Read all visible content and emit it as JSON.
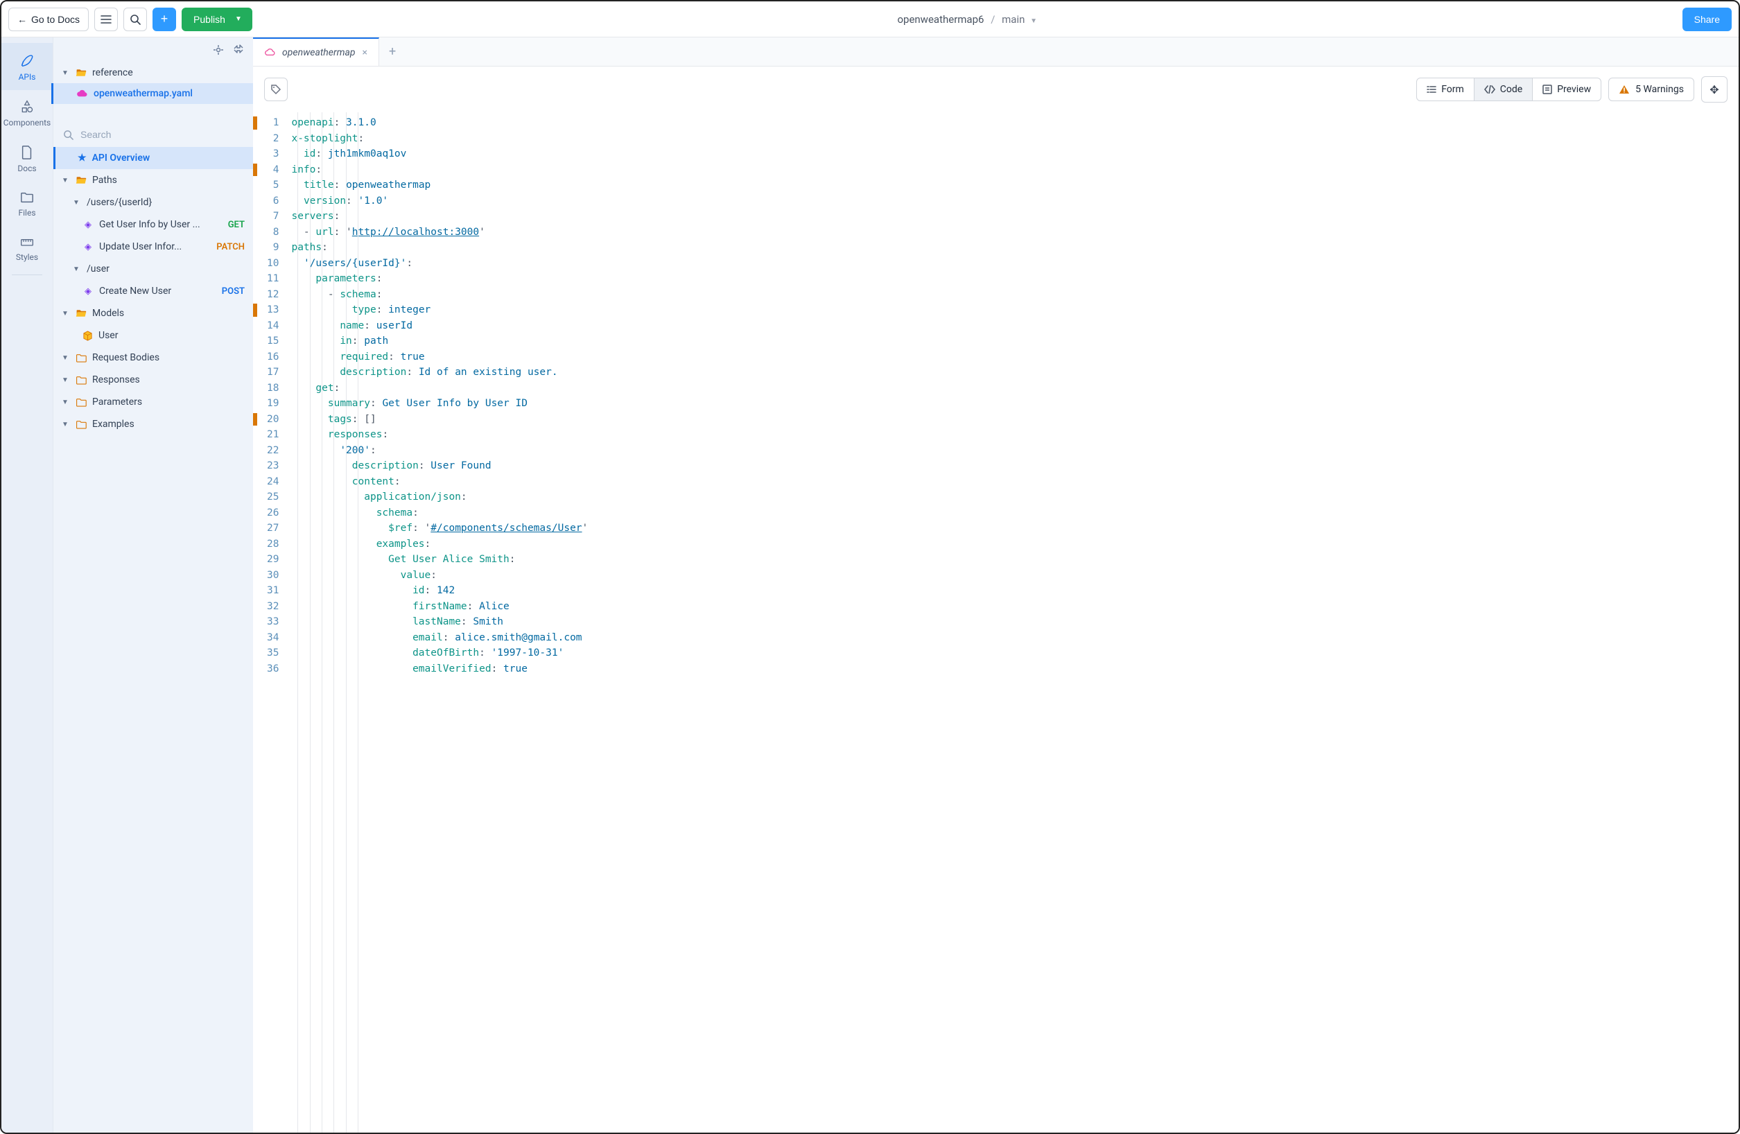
{
  "topbar": {
    "back_label": "Go to Docs",
    "publish_label": "Publish",
    "share_label": "Share",
    "project": "openweathermap6",
    "branch": "main"
  },
  "rail": {
    "apis": "APIs",
    "components": "Components",
    "docs": "Docs",
    "files": "Files",
    "styles": "Styles"
  },
  "sidebar": {
    "folder": "reference",
    "file": "openweathermap.yaml",
    "search_placeholder": "Search",
    "api_overview": "API Overview",
    "paths": "Paths",
    "path_users_id": "/users/{userId}",
    "op_get_user": "Get User Info by User ...",
    "op_get_user_method": "GET",
    "op_update_user": "Update User Infor...",
    "op_update_user_method": "PATCH",
    "path_user": "/user",
    "op_create_user": "Create New User",
    "op_create_user_method": "POST",
    "models": "Models",
    "model_user": "User",
    "request_bodies": "Request Bodies",
    "responses": "Responses",
    "parameters": "Parameters",
    "examples": "Examples"
  },
  "tab": {
    "title": "openweathermap"
  },
  "toolbar": {
    "form": "Form",
    "code": "Code",
    "preview": "Preview",
    "warnings": "5 Warnings"
  },
  "code": {
    "lines": [
      [
        [
          "key",
          "openapi"
        ],
        [
          "punc",
          ": "
        ],
        [
          "str",
          "3.1.0"
        ]
      ],
      [
        [
          "key",
          "x-stoplight"
        ],
        [
          "punc",
          ":"
        ]
      ],
      [
        [
          "punc",
          "  "
        ],
        [
          "key",
          "id"
        ],
        [
          "punc",
          ": "
        ],
        [
          "str",
          "jth1mkm0aq1ov"
        ]
      ],
      [
        [
          "key",
          "info"
        ],
        [
          "punc",
          ":"
        ]
      ],
      [
        [
          "punc",
          "  "
        ],
        [
          "key",
          "title"
        ],
        [
          "punc",
          ": "
        ],
        [
          "str",
          "openweathermap"
        ]
      ],
      [
        [
          "punc",
          "  "
        ],
        [
          "key",
          "version"
        ],
        [
          "punc",
          ": "
        ],
        [
          "str",
          "'1.0'"
        ]
      ],
      [
        [
          "key",
          "servers"
        ],
        [
          "punc",
          ":"
        ]
      ],
      [
        [
          "punc",
          "  - "
        ],
        [
          "key",
          "url"
        ],
        [
          "punc",
          ": '"
        ],
        [
          "url",
          "http://localhost:3000"
        ],
        [
          "punc",
          "'"
        ]
      ],
      [
        [
          "key",
          "paths"
        ],
        [
          "punc",
          ":"
        ]
      ],
      [
        [
          "punc",
          "  "
        ],
        [
          "str",
          "'/users/{userId}'"
        ],
        [
          "punc",
          ":"
        ]
      ],
      [
        [
          "punc",
          "    "
        ],
        [
          "key",
          "parameters"
        ],
        [
          "punc",
          ":"
        ]
      ],
      [
        [
          "punc",
          "      - "
        ],
        [
          "key",
          "schema"
        ],
        [
          "punc",
          ":"
        ]
      ],
      [
        [
          "punc",
          "          "
        ],
        [
          "key",
          "type"
        ],
        [
          "punc",
          ": "
        ],
        [
          "str",
          "integer"
        ]
      ],
      [
        [
          "punc",
          "        "
        ],
        [
          "key",
          "name"
        ],
        [
          "punc",
          ": "
        ],
        [
          "str",
          "userId"
        ]
      ],
      [
        [
          "punc",
          "        "
        ],
        [
          "key",
          "in"
        ],
        [
          "punc",
          ": "
        ],
        [
          "str",
          "path"
        ]
      ],
      [
        [
          "punc",
          "        "
        ],
        [
          "key",
          "required"
        ],
        [
          "punc",
          ": "
        ],
        [
          "bool",
          "true"
        ]
      ],
      [
        [
          "punc",
          "        "
        ],
        [
          "key",
          "description"
        ],
        [
          "punc",
          ": "
        ],
        [
          "str",
          "Id of an existing user."
        ]
      ],
      [
        [
          "punc",
          "    "
        ],
        [
          "key",
          "get"
        ],
        [
          "punc",
          ":"
        ]
      ],
      [
        [
          "punc",
          "      "
        ],
        [
          "key",
          "summary"
        ],
        [
          "punc",
          ": "
        ],
        [
          "str",
          "Get User Info by User ID"
        ]
      ],
      [
        [
          "punc",
          "      "
        ],
        [
          "key",
          "tags"
        ],
        [
          "punc",
          ": []"
        ]
      ],
      [
        [
          "punc",
          "      "
        ],
        [
          "key",
          "responses"
        ],
        [
          "punc",
          ":"
        ]
      ],
      [
        [
          "punc",
          "        "
        ],
        [
          "str",
          "'200'"
        ],
        [
          "punc",
          ":"
        ]
      ],
      [
        [
          "punc",
          "          "
        ],
        [
          "key",
          "description"
        ],
        [
          "punc",
          ": "
        ],
        [
          "str",
          "User Found"
        ]
      ],
      [
        [
          "punc",
          "          "
        ],
        [
          "key",
          "content"
        ],
        [
          "punc",
          ":"
        ]
      ],
      [
        [
          "punc",
          "            "
        ],
        [
          "key",
          "application/json"
        ],
        [
          "punc",
          ":"
        ]
      ],
      [
        [
          "punc",
          "              "
        ],
        [
          "key",
          "schema"
        ],
        [
          "punc",
          ":"
        ]
      ],
      [
        [
          "punc",
          "                "
        ],
        [
          "key",
          "$ref"
        ],
        [
          "punc",
          ": '"
        ],
        [
          "url",
          "#/components/schemas/User"
        ],
        [
          "punc",
          "'"
        ]
      ],
      [
        [
          "punc",
          "              "
        ],
        [
          "key",
          "examples"
        ],
        [
          "punc",
          ":"
        ]
      ],
      [
        [
          "punc",
          "                "
        ],
        [
          "key",
          "Get User Alice Smith"
        ],
        [
          "punc",
          ":"
        ]
      ],
      [
        [
          "punc",
          "                  "
        ],
        [
          "key",
          "value"
        ],
        [
          "punc",
          ":"
        ]
      ],
      [
        [
          "punc",
          "                    "
        ],
        [
          "key",
          "id"
        ],
        [
          "punc",
          ": "
        ],
        [
          "num",
          "142"
        ]
      ],
      [
        [
          "punc",
          "                    "
        ],
        [
          "key",
          "firstName"
        ],
        [
          "punc",
          ": "
        ],
        [
          "str",
          "Alice"
        ]
      ],
      [
        [
          "punc",
          "                    "
        ],
        [
          "key",
          "lastName"
        ],
        [
          "punc",
          ": "
        ],
        [
          "str",
          "Smith"
        ]
      ],
      [
        [
          "punc",
          "                    "
        ],
        [
          "key",
          "email"
        ],
        [
          "punc",
          ": "
        ],
        [
          "str",
          "alice.smith@gmail.com"
        ]
      ],
      [
        [
          "punc",
          "                    "
        ],
        [
          "key",
          "dateOfBirth"
        ],
        [
          "punc",
          ": "
        ],
        [
          "str",
          "'1997-10-31'"
        ]
      ],
      [
        [
          "punc",
          "                    "
        ],
        [
          "key",
          "emailVerified"
        ],
        [
          "punc",
          ": "
        ],
        [
          "bool",
          "true"
        ]
      ]
    ],
    "markers": [
      1,
      4,
      13,
      20
    ]
  }
}
